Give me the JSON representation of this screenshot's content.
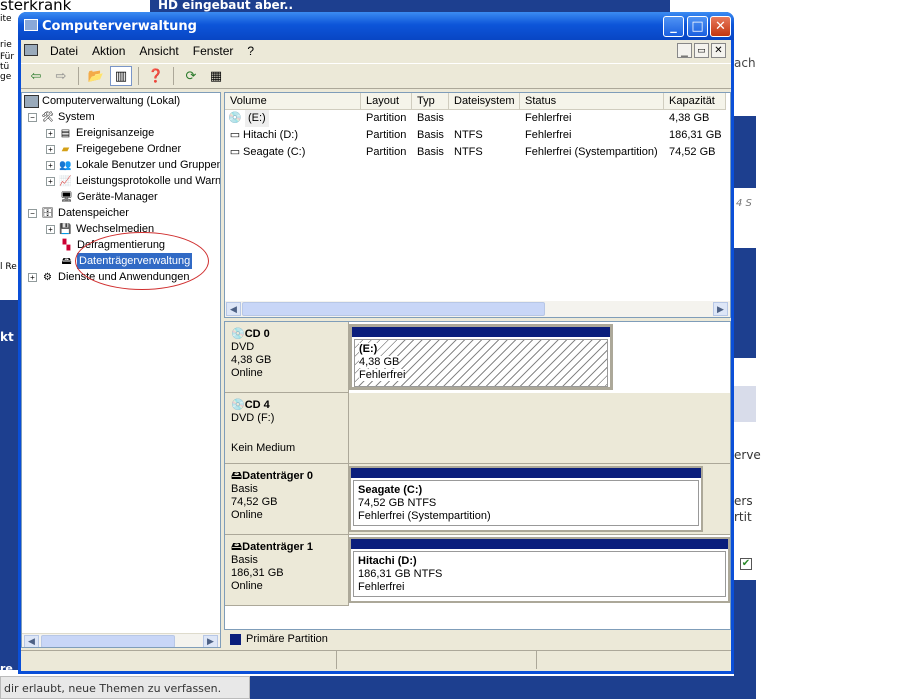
{
  "background": {
    "top_tab": "HD eingebaut aber..",
    "left_texts": [
      "sterkrank",
      "ite",
      "rie",
      "Für",
      "tü",
      "ge",
      "l Re",
      "kt",
      "re"
    ],
    "right_texts": [
      "ach",
      "4 S",
      "erve",
      "ers",
      "rtit"
    ],
    "bottom_text": "dir erlaubt, neue Themen zu verfassen."
  },
  "window": {
    "title": "Computerverwaltung",
    "title_icon": "computer-icon",
    "minimize": "_",
    "maximize": "□",
    "close": "✕"
  },
  "menu": {
    "items": [
      "Datei",
      "Aktion",
      "Ansicht",
      "Fenster",
      "?"
    ],
    "doc_min": "_",
    "doc_restore": "▭",
    "doc_close": "✕"
  },
  "tree": {
    "items": [
      {
        "label": "Computerverwaltung (Lokal)",
        "level": 0,
        "expander": ""
      },
      {
        "label": "System",
        "level": 1,
        "expander": "−"
      },
      {
        "label": "Ereignisanzeige",
        "level": 2,
        "expander": "+"
      },
      {
        "label": "Freigegebene Ordner",
        "level": 2,
        "expander": "+"
      },
      {
        "label": "Lokale Benutzer und Gruppen",
        "level": 2,
        "expander": "+"
      },
      {
        "label": "Leistungsprotokolle und Warnungen",
        "level": 2,
        "expander": "+"
      },
      {
        "label": "Geräte-Manager",
        "level": 2,
        "expander": ""
      },
      {
        "label": "Datenspeicher",
        "level": 1,
        "expander": "−"
      },
      {
        "label": "Wechselmedien",
        "level": 2,
        "expander": "+"
      },
      {
        "label": "Defragmentierung",
        "level": 2,
        "expander": ""
      },
      {
        "label": "Datenträgerverwaltung",
        "level": 2,
        "expander": "",
        "selected": true
      },
      {
        "label": "Dienste und Anwendungen",
        "level": 1,
        "expander": "+"
      }
    ]
  },
  "volumes": {
    "columns": [
      "Volume",
      "Layout",
      "Typ",
      "Dateisystem",
      "Status",
      "Kapazität"
    ],
    "rows": [
      [
        "(E:)",
        "Partition",
        "Basis",
        "",
        "Fehlerfrei",
        "4,38 GB"
      ],
      [
        "Hitachi (D:)",
        "Partition",
        "Basis",
        "NTFS",
        "Fehlerfrei",
        "186,31 GB"
      ],
      [
        "Seagate (C:)",
        "Partition",
        "Basis",
        "NTFS",
        "Fehlerfrei (Systempartition)",
        "74,52 GB"
      ]
    ]
  },
  "disks": [
    {
      "title": "CD 0",
      "type": "DVD",
      "size": "4,38 GB",
      "state": "Online",
      "volume": {
        "name": "(E:)",
        "size": "4,38 GB",
        "status": "Fehlerfrei"
      }
    },
    {
      "title": "CD 4",
      "type": "DVD (F:)",
      "size": "",
      "state": "Kein Medium",
      "volume": null
    },
    {
      "title": "Datenträger 0",
      "type": "Basis",
      "size": "74,52 GB",
      "state": "Online",
      "volume": {
        "name": "Seagate  (C:)",
        "size": "74,52 GB NTFS",
        "status": "Fehlerfrei (Systempartition)"
      }
    },
    {
      "title": "Datenträger 1",
      "type": "Basis",
      "size": "186,31 GB",
      "state": "Online",
      "volume": {
        "name": "Hitachi  (D:)",
        "size": "186,31 GB NTFS",
        "status": "Fehlerfrei"
      }
    }
  ],
  "legend": {
    "label": "Primäre Partition",
    "color": "#0a1e7c"
  },
  "colors": {
    "titlebar": "#0d55d9",
    "accent": "#0a1e7c",
    "selection": "#316ac5",
    "annotation": "#d03030"
  }
}
